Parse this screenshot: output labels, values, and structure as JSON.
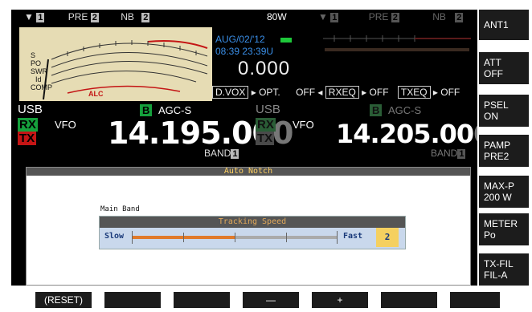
{
  "colors": {
    "screen_bg": "#000000",
    "meter_face": "#e6dcb4",
    "rx_green": "#15a03c",
    "tx_red": "#c41515",
    "accent_orange": "#e07a2a",
    "slider_bg": "#c9d8ec"
  },
  "top_status_left": {
    "antenna_icon": "antenna-icon",
    "ant_num": "1",
    "pre_label": "PRE",
    "pre_num": "2",
    "nb_label": "NB",
    "nb_num": "2"
  },
  "top_status_right": {
    "antenna_icon": "antenna-icon",
    "ant_num": "1",
    "pre_label": "PRE",
    "pre_num": "2",
    "nb_label": "NB",
    "nb_num": "2"
  },
  "power_label": "80W",
  "meter": {
    "labels": [
      "S",
      "PO",
      "SWR",
      "Id",
      "COMP",
      "ALC"
    ]
  },
  "date": "AUG/02/'12",
  "time": "08:39 23:39U",
  "tx_delay": "0.000",
  "buttons_row": {
    "dvox": "D.VOX",
    "opt": "OPT.",
    "off1": "OFF",
    "rxeq": "RXEQ",
    "off2": "OFF",
    "txeq": "TXEQ",
    "off3": "OFF"
  },
  "main_band": {
    "mode": "USB",
    "rx": "RX",
    "tx": "TX",
    "vfo": "VFO",
    "agc_tag": "B",
    "agc": "AGC-S",
    "frequency": "14.195.00",
    "freq_last": "0",
    "band_label": "BAND",
    "band_num": "1"
  },
  "sub_band": {
    "mode": "USB",
    "rx": "RX",
    "tx": "TX",
    "vfo": "VFO",
    "agc_tag": "B",
    "agc": "AGC-S",
    "frequency": "14.205.00",
    "freq_last": "0",
    "band_label": "BAND",
    "band_num": "1"
  },
  "dialog": {
    "title": "Auto Notch",
    "section": "Main Band",
    "slider_title": "Tracking Speed",
    "slow": "Slow",
    "fast": "Fast",
    "value": "2",
    "level": 0.5
  },
  "right_keys": [
    {
      "line1": "ANT1",
      "line2": ""
    },
    {
      "line1": "ATT",
      "line2": "OFF"
    },
    {
      "line1": "PSEL",
      "line2": "ON"
    },
    {
      "line1": "PAMP",
      "line2": "PRE2"
    },
    {
      "line1": "MAX-P",
      "line2": "200 W"
    },
    {
      "line1": "METER",
      "line2": "Po"
    },
    {
      "line1": "TX-FIL",
      "line2": "FIL-A"
    }
  ],
  "bottom_keys": [
    "(RESET)",
    "",
    "",
    "—",
    "+",
    "",
    ""
  ]
}
